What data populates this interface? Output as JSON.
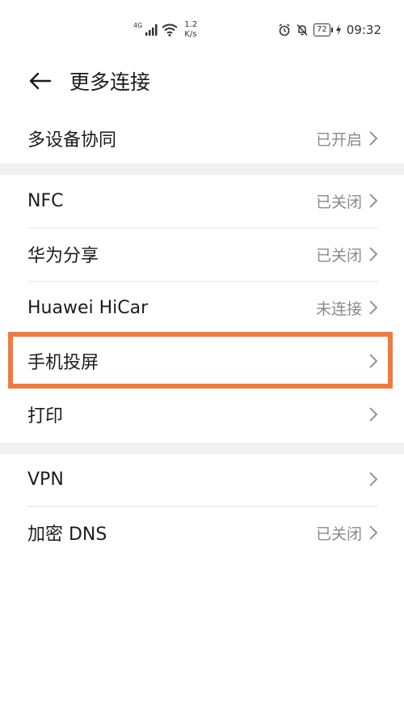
{
  "status_bar": {
    "network": "4G",
    "speed_value": "1.2",
    "speed_unit": "K/s",
    "battery": "72",
    "time": "09:32"
  },
  "header": {
    "title": "更多连接"
  },
  "groups": [
    {
      "items": [
        {
          "label": "多设备协同",
          "value": "已开启"
        }
      ]
    },
    {
      "items": [
        {
          "label": "NFC",
          "value": "已关闭"
        },
        {
          "label": "华为分享",
          "value": "已关闭"
        },
        {
          "label": "Huawei HiCar",
          "value": "未连接"
        },
        {
          "label": "手机投屏",
          "value": ""
        },
        {
          "label": "打印",
          "value": ""
        }
      ]
    },
    {
      "items": [
        {
          "label": "VPN",
          "value": ""
        },
        {
          "label": "加密 DNS",
          "value": "已关闭"
        }
      ]
    }
  ],
  "colors": {
    "highlight": "#f07a3e",
    "divider": "#f1f1f1",
    "secondary_text": "#8a8a8a"
  }
}
